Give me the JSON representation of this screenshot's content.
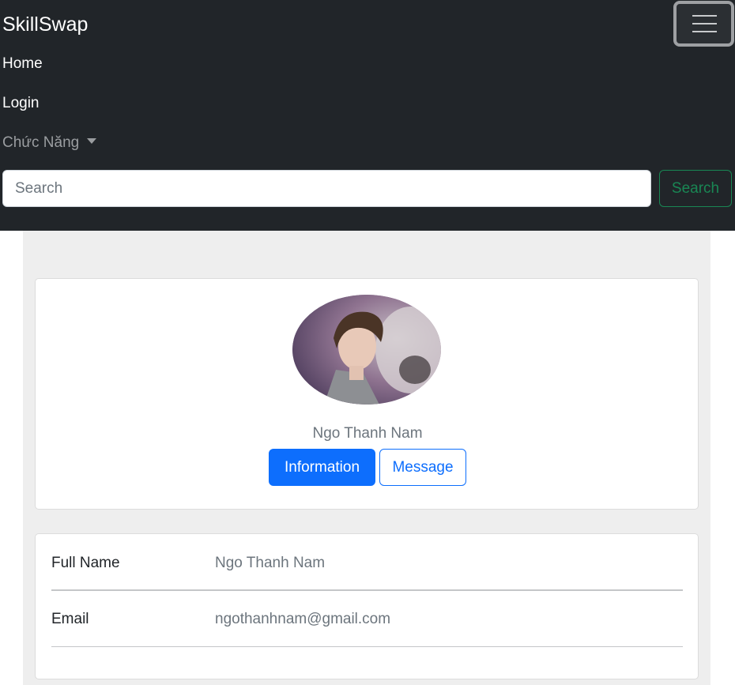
{
  "navbar": {
    "brand": "SkillSwap",
    "links": [
      {
        "label": "Home"
      },
      {
        "label": "Login"
      }
    ],
    "dropdown_label": "Chức Năng",
    "search": {
      "placeholder": "Search",
      "button_label": "Search"
    }
  },
  "profile": {
    "name": "Ngo Thanh Nam",
    "buttons": {
      "information": "Information",
      "message": "Message"
    }
  },
  "details": [
    {
      "label": "Full Name",
      "value": "Ngo Thanh Nam"
    },
    {
      "label": "Email",
      "value": "ngothanhnam@gmail.com"
    }
  ],
  "colors": {
    "navbar_bg": "#212529",
    "primary": "#0d6efd",
    "success": "#198754",
    "content_bg": "#eeeeee"
  },
  "icons": {
    "toggler": "hamburger-menu-icon",
    "dropdown": "caret-down-icon"
  }
}
